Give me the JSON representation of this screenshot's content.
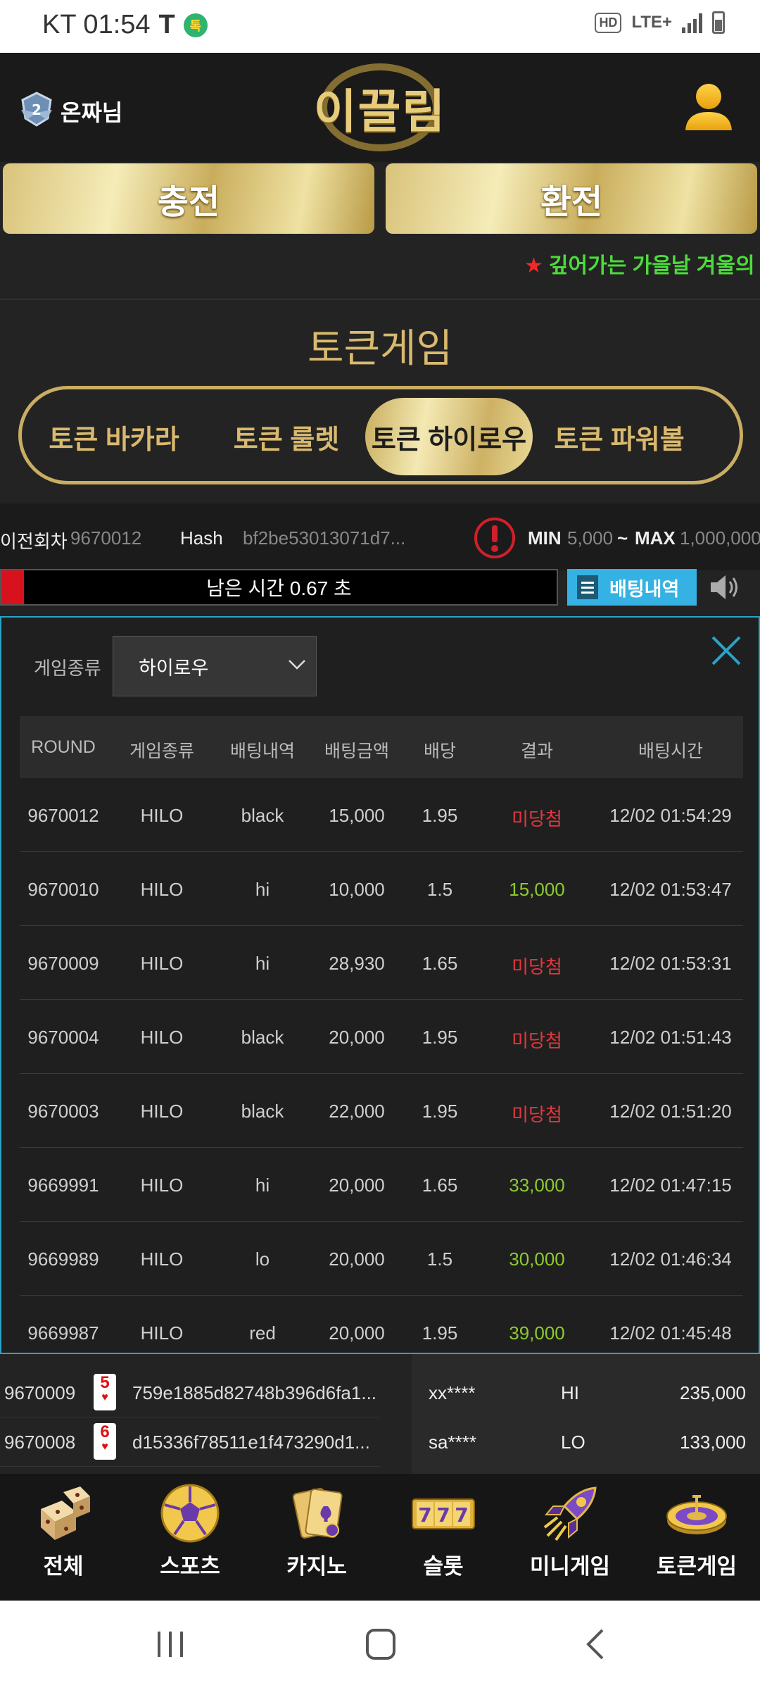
{
  "status_bar": {
    "carrier_time": "KT 01:54",
    "t_icon": "T",
    "kakao_badge": "톡",
    "hd": "HD",
    "network": "LTE+"
  },
  "header": {
    "user_name": "온짜님",
    "level": "2",
    "logo_text": "이끌림"
  },
  "actions": {
    "charge": "충전",
    "exchange": "환전"
  },
  "marquee": {
    "star": "★",
    "text": "깊어가는 가을날 겨울의"
  },
  "section_title": "토큰게임",
  "tabs": [
    "토큰 바카라",
    "토큰 룰렛",
    "토큰 하이로우",
    "토큰 파워볼"
  ],
  "active_tab": 2,
  "info": {
    "prev_round_label": "이전회차",
    "prev_round": "9670012",
    "hash_label": "Hash",
    "hash": "bf2be53013071d7...",
    "min_label": "MIN",
    "min": "5,000",
    "tilde": "~",
    "max_label": "MAX",
    "max": "1,000,000"
  },
  "timer": {
    "text": "남은 시간 0.67 초",
    "progress": 0.04
  },
  "bet_history_button": "배팅내역",
  "modal": {
    "filter_label": "게임종류",
    "filter_value": "하이로우",
    "columns": [
      "ROUND",
      "게임종류",
      "배팅내역",
      "배팅금액",
      "배당",
      "결과",
      "배팅시간"
    ],
    "rows": [
      [
        "9670012",
        "HILO",
        "black",
        "15,000",
        "1.95",
        "미당첨",
        "12/02 01:54:29"
      ],
      [
        "9670010",
        "HILO",
        "hi",
        "10,000",
        "1.5",
        "15,000",
        "12/02 01:53:47"
      ],
      [
        "9670009",
        "HILO",
        "hi",
        "28,930",
        "1.65",
        "미당첨",
        "12/02 01:53:31"
      ],
      [
        "9670004",
        "HILO",
        "black",
        "20,000",
        "1.95",
        "미당첨",
        "12/02 01:51:43"
      ],
      [
        "9670003",
        "HILO",
        "black",
        "22,000",
        "1.95",
        "미당첨",
        "12/02 01:51:20"
      ],
      [
        "9669991",
        "HILO",
        "hi",
        "20,000",
        "1.65",
        "33,000",
        "12/02 01:47:15"
      ],
      [
        "9669989",
        "HILO",
        "lo",
        "20,000",
        "1.5",
        "30,000",
        "12/02 01:46:34"
      ],
      [
        "9669987",
        "HILO",
        "red",
        "20,000",
        "1.95",
        "39,000",
        "12/02 01:45:48"
      ]
    ],
    "lose_color": "#e0383f",
    "win_color": "#8ccb2f"
  },
  "history": [
    {
      "round": "9670009",
      "card": "5",
      "hash": "759e1885d82748b396d6fa1..."
    },
    {
      "round": "9670008",
      "card": "6",
      "hash": "d15336f78511e1f473290d1..."
    }
  ],
  "live_bets": [
    {
      "user": "xx****",
      "pick": "HI",
      "amount": "235,000"
    },
    {
      "user": "sa****",
      "pick": "LO",
      "amount": "133,000"
    }
  ],
  "bottom_nav": [
    {
      "label": "전체",
      "icon": "dice-icon"
    },
    {
      "label": "스포츠",
      "icon": "soccer-ball-icon"
    },
    {
      "label": "카지노",
      "icon": "playing-cards-icon"
    },
    {
      "label": "슬롯",
      "icon": "slot-777-icon"
    },
    {
      "label": "미니게임",
      "icon": "rocket-icon"
    },
    {
      "label": "토큰게임",
      "icon": "roulette-icon"
    }
  ],
  "colors": {
    "gold": "#d9b96e",
    "accent_blue": "#35b2e3",
    "timer_red": "#d8121d"
  }
}
